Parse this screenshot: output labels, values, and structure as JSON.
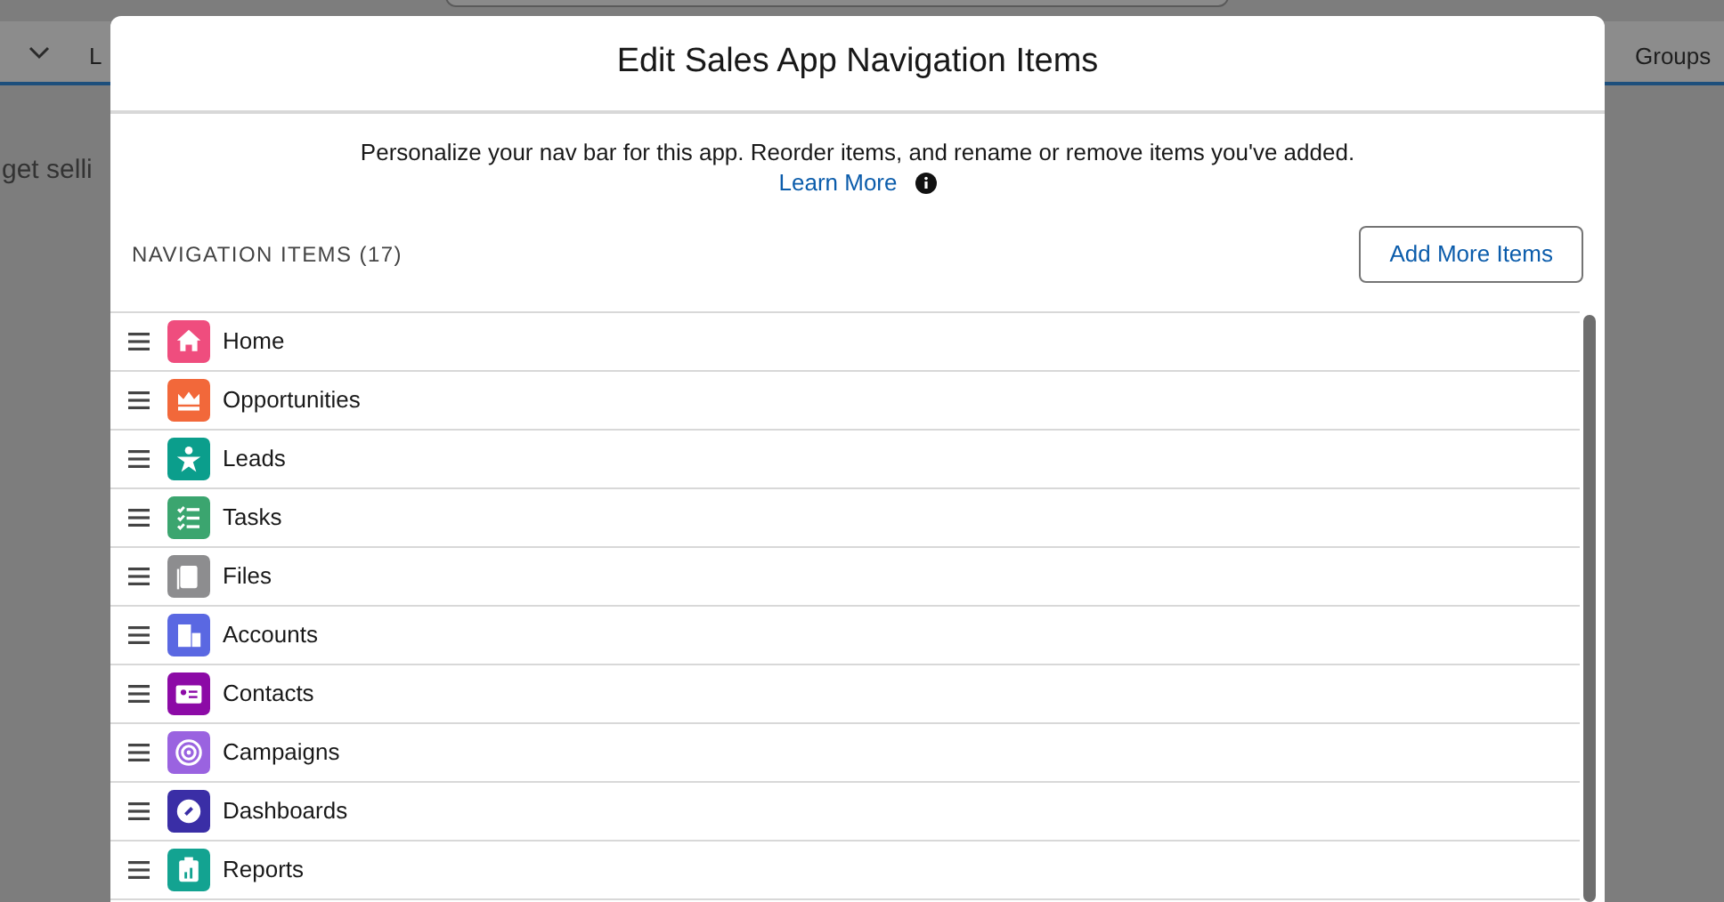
{
  "background": {
    "nav_items": [
      "L",
      "Groups"
    ],
    "body_text": "get selli"
  },
  "modal": {
    "title": "Edit Sales App Navigation Items",
    "description": "Personalize your nav bar for this app. Reorder items, and rename or remove items you've added.",
    "learn_more": "Learn More",
    "section_title": "NAVIGATION ITEMS (17)",
    "add_button": "Add More Items",
    "items": [
      {
        "label": "Home",
        "color": "#ef4d7e"
      },
      {
        "label": "Opportunities",
        "color": "#f2683a"
      },
      {
        "label": "Leads",
        "color": "#0b9e8c"
      },
      {
        "label": "Tasks",
        "color": "#3ba56f"
      },
      {
        "label": "Files",
        "color": "#8d8d8f"
      },
      {
        "label": "Accounts",
        "color": "#5a68e2"
      },
      {
        "label": "Contacts",
        "color": "#8c0aa6"
      },
      {
        "label": "Campaigns",
        "color": "#9a63e0"
      },
      {
        "label": "Dashboards",
        "color": "#3a2ea6"
      },
      {
        "label": "Reports",
        "color": "#13a391"
      }
    ]
  }
}
